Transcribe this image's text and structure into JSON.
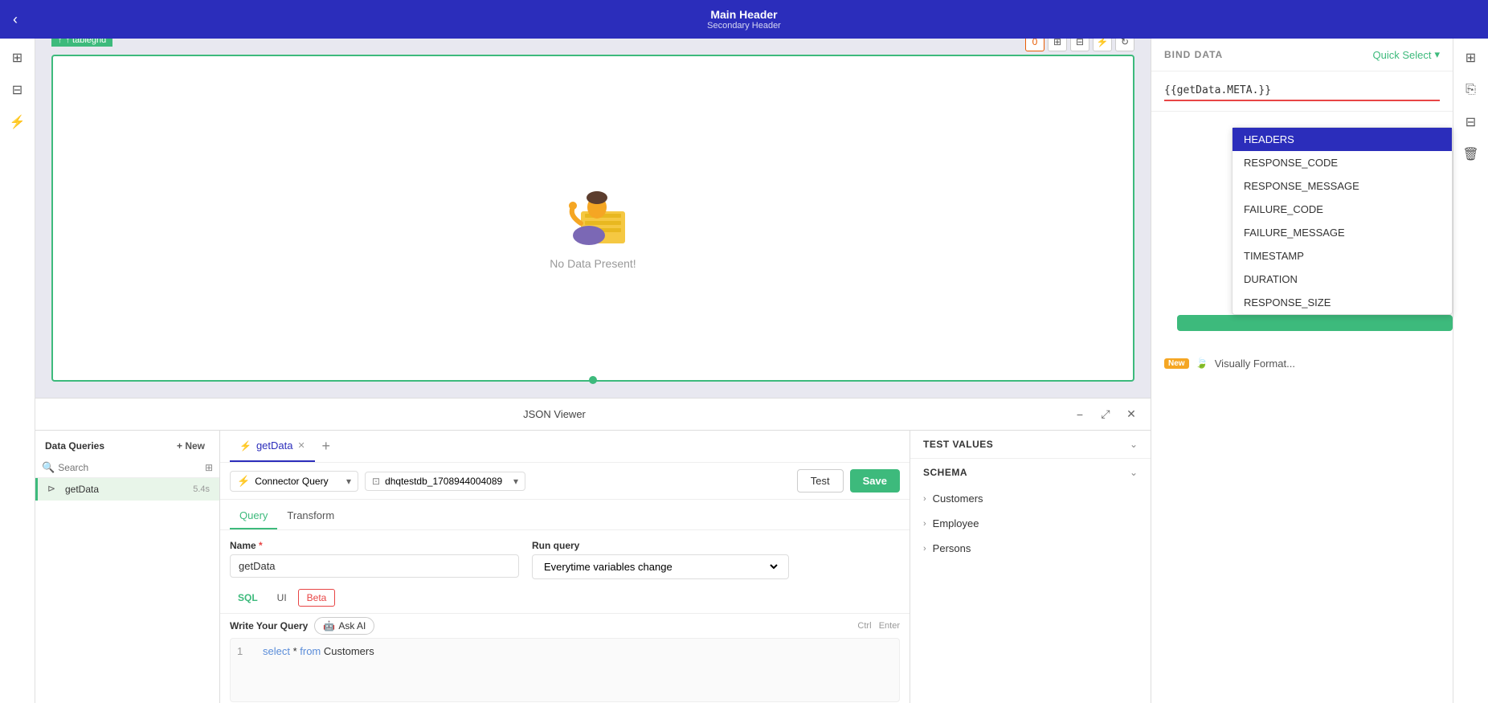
{
  "header": {
    "main": "Main Header",
    "secondary": "Secondary Header",
    "back_label": "‹"
  },
  "canvas": {
    "tablegrid_label": "↑ tablegrid",
    "no_data_text": "No Data Present!",
    "json_viewer_label": "JSON Viewer"
  },
  "data_queries": {
    "title": "Data Queries",
    "new_label": "+ New",
    "search_placeholder": "Search",
    "filter_icon": "⊞",
    "items": [
      {
        "name": "getData",
        "time": "5.4s",
        "icon": "⊳"
      }
    ]
  },
  "query_editor": {
    "tabs": [
      {
        "name": "getData",
        "icon": "⚡",
        "active": true
      },
      {
        "name": "add",
        "icon": "+"
      }
    ],
    "type_select": {
      "label": "Connector Query",
      "icon": "⚡",
      "chevron": "▾"
    },
    "datasource_select": {
      "label": "dhqtestdb_1708944004089",
      "icon": "⊡",
      "chevron": "▾"
    },
    "test_btn": "Test",
    "save_btn": "Save",
    "subtabs": [
      "Query",
      "Transform"
    ],
    "active_subtab": "Query",
    "name_label": "Name",
    "name_required": "*",
    "name_value": "getData",
    "run_query_label": "Run query",
    "run_query_value": "Everytime variables change",
    "sql_tabs": [
      "SQL",
      "UI",
      "Beta"
    ],
    "active_sql_tab": "SQL",
    "write_query_label": "Write Your Query",
    "ask_ai_label": "Ask AI",
    "ctrl_label": "Ctrl",
    "enter_label": "Enter",
    "code_line": "select * from Customers",
    "line_number": "1"
  },
  "bind_data": {
    "title": "BIND DATA",
    "quick_select_label": "Quick Select",
    "input_value": "{{getData.META.}}",
    "dropdown_items": [
      {
        "label": "HEADERS",
        "selected": true
      },
      {
        "label": "RESPONSE_CODE",
        "selected": false
      },
      {
        "label": "RESPONSE_MESSAGE",
        "selected": false
      },
      {
        "label": "FAILURE_CODE",
        "selected": false
      },
      {
        "label": "FAILURE_MESSAGE",
        "selected": false
      },
      {
        "label": "TIMESTAMP",
        "selected": false
      },
      {
        "label": "DURATION",
        "selected": false
      },
      {
        "label": "RESPONSE_SIZE",
        "selected": false
      }
    ],
    "green_btn_label": "",
    "new_badge": "New",
    "visually_format_label": "Visually Format..."
  },
  "test_values": {
    "title": "TEST VALUES",
    "chevron": "⌄"
  },
  "schema": {
    "title": "SCHEMA",
    "chevron": "⌄",
    "items": [
      {
        "name": "Customers"
      },
      {
        "name": "Employee"
      },
      {
        "name": "Persons"
      }
    ]
  },
  "right_icons": [
    {
      "icon": "⊞",
      "name": "pages-icon"
    },
    {
      "icon": "⎘",
      "name": "copy-icon"
    },
    {
      "icon": "⊟",
      "name": "layers-icon"
    },
    {
      "icon": "🗑",
      "name": "delete-icon"
    }
  ]
}
